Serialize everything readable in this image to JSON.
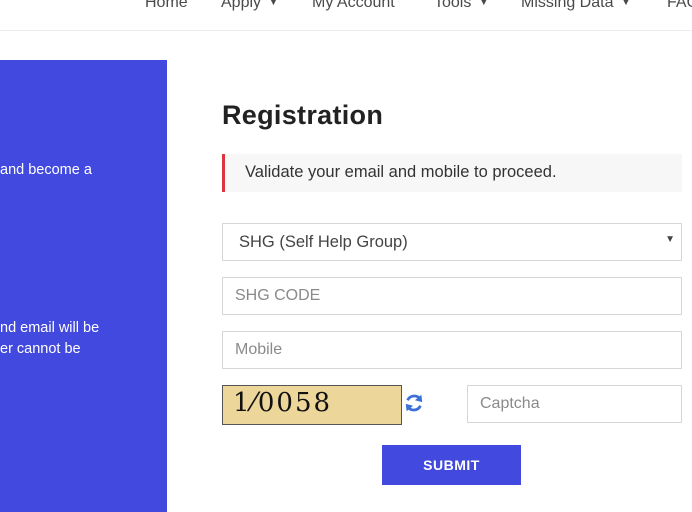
{
  "nav": {
    "items": [
      {
        "label": "Home",
        "dropdown": false
      },
      {
        "label": "Apply",
        "dropdown": true
      },
      {
        "label": "My Account",
        "dropdown": false
      },
      {
        "label": "Tools",
        "dropdown": true
      },
      {
        "label": "Missing Data",
        "dropdown": true
      },
      {
        "label": "FAQ",
        "dropdown": false
      }
    ]
  },
  "left_panel": {
    "line1": "and become a",
    "line2": "nd email will be",
    "line3": "er cannot be"
  },
  "form": {
    "title": "Registration",
    "alert": "Validate your email and mobile to proceed.",
    "category_selected": "SHG (Self Help Group)",
    "shg_code_placeholder": "SHG CODE",
    "mobile_placeholder": "Mobile",
    "captcha_text": "1⁄0058",
    "captcha_placeholder": "Captcha",
    "submit_label": "SUBMIT"
  },
  "colors": {
    "accent": "#4149de",
    "alert_border": "#d9363e",
    "captcha_bg": "#ecd69a"
  },
  "icons": [
    "chevron-down-icon",
    "refresh-icon"
  ]
}
